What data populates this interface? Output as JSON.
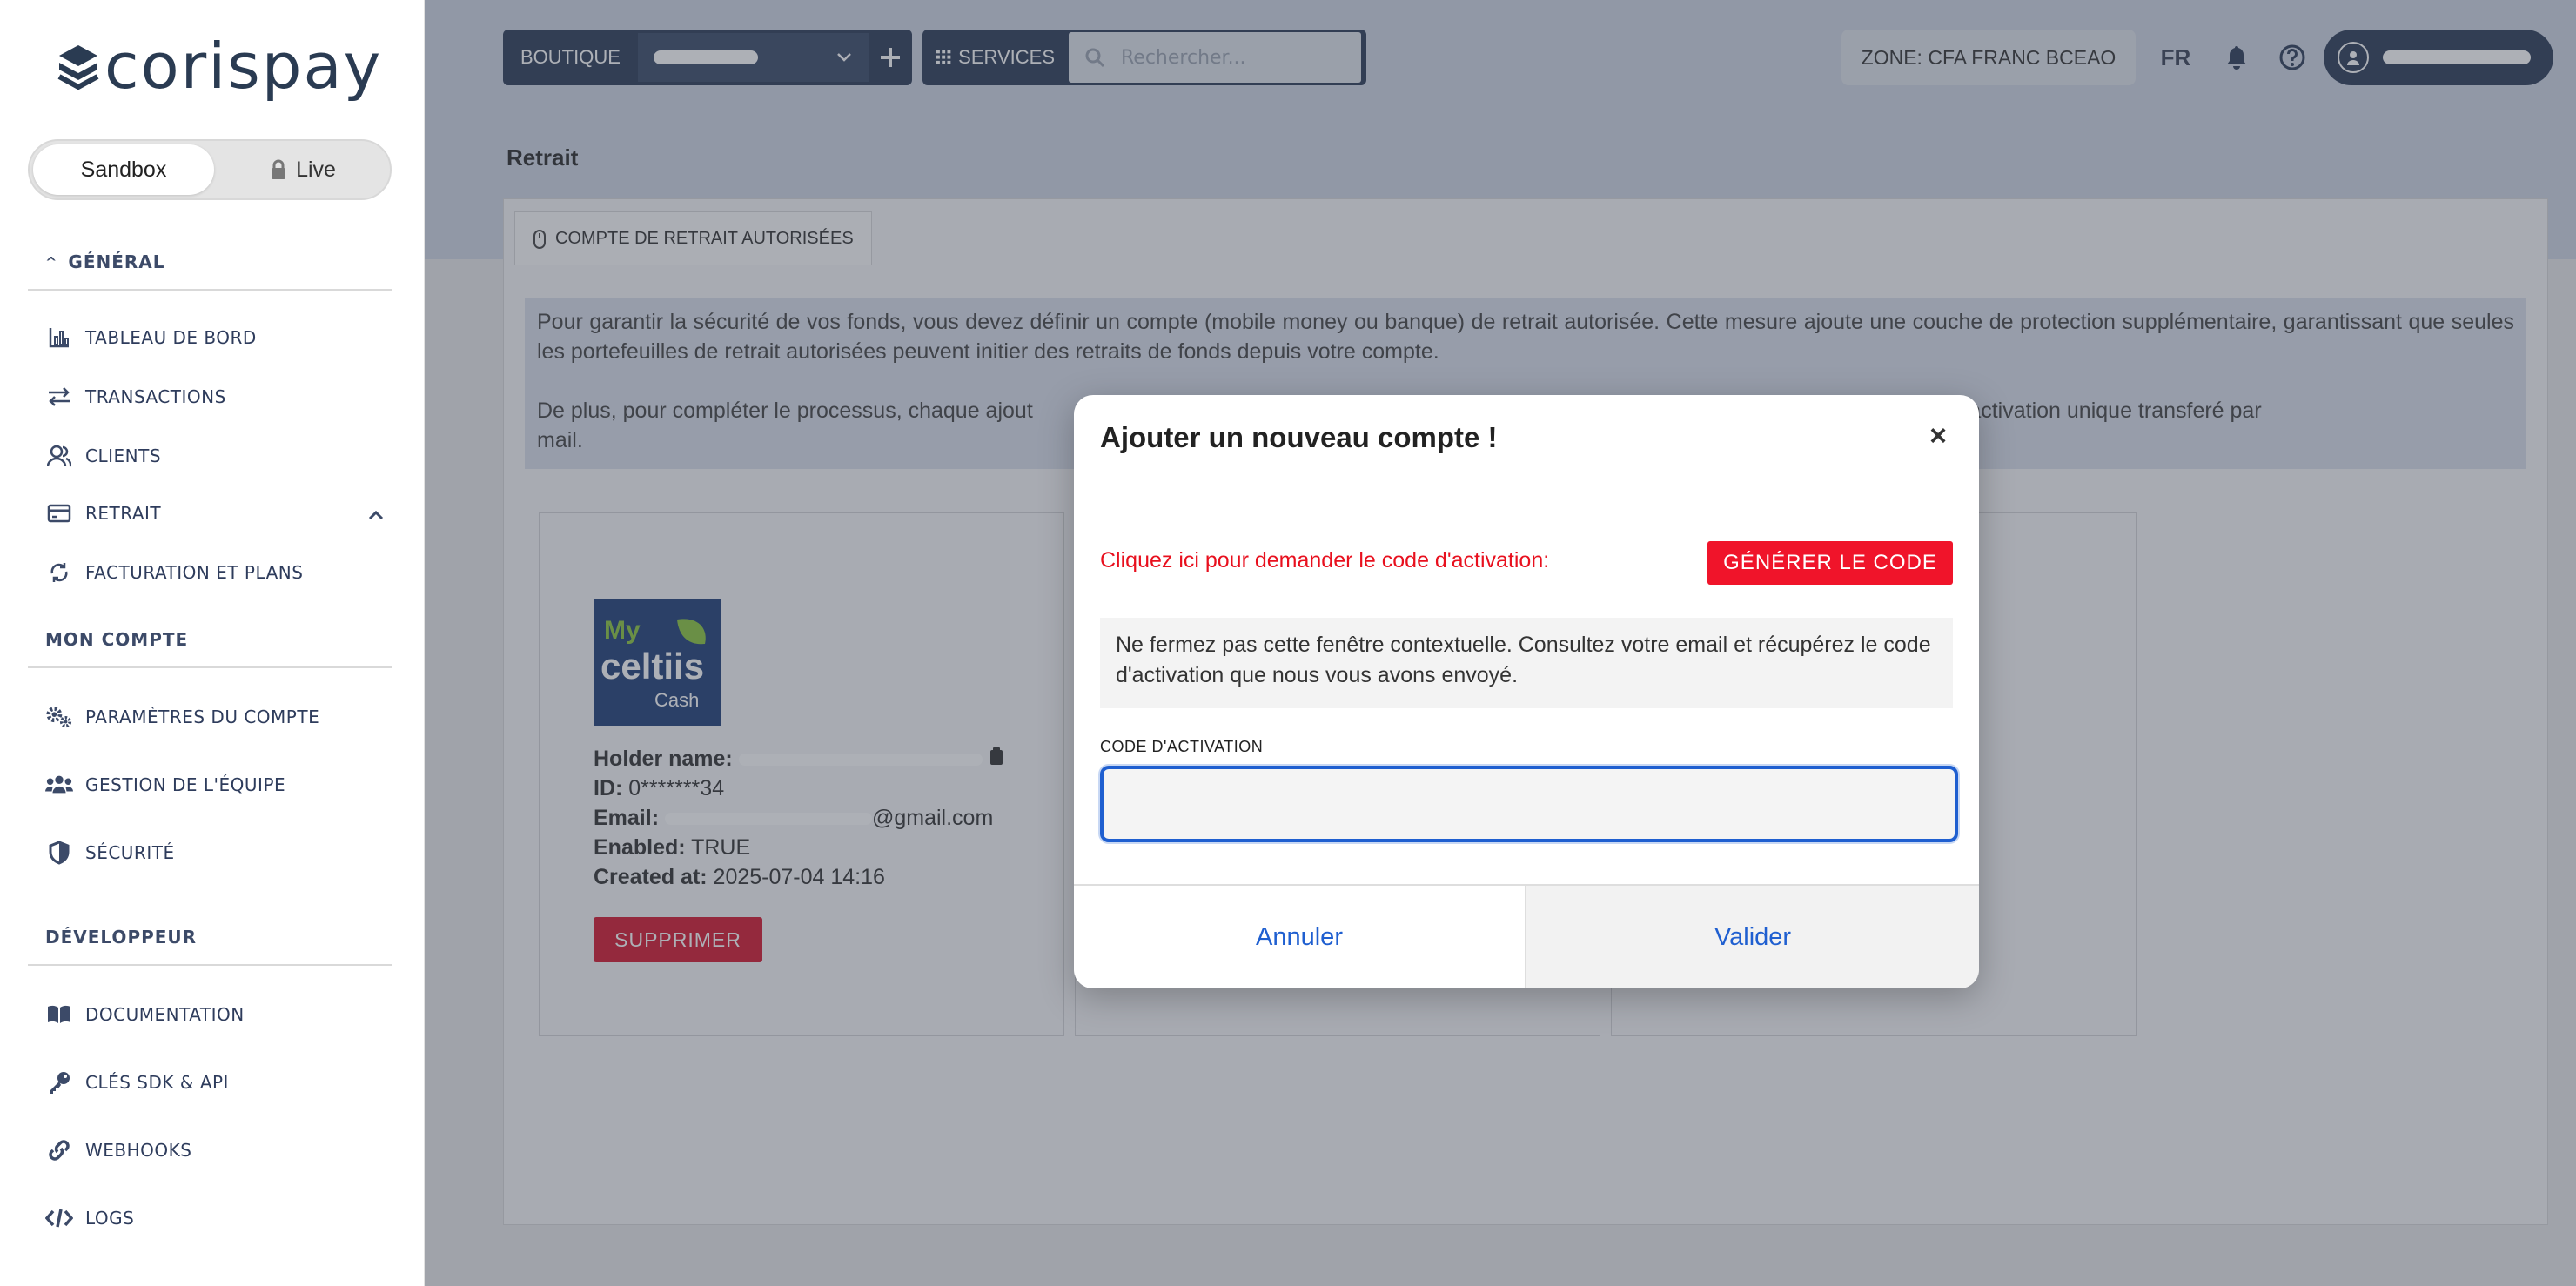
{
  "brand": {
    "name": "corispay"
  },
  "environment": {
    "sandbox": "Sandbox",
    "live": "Live"
  },
  "nav": {
    "general": {
      "title": "GÉNÉRAL",
      "items": [
        "TABLEAU DE BORD",
        "TRANSACTIONS",
        "CLIENTS",
        "RETRAIT",
        "FACTURATION ET PLANS"
      ]
    },
    "account": {
      "title": "MON COMPTE",
      "items": [
        "PARAMÈTRES DU COMPTE",
        "GESTION DE L'ÉQUIPE",
        "SÉCURITÉ"
      ]
    },
    "developer": {
      "title": "DÉVELOPPEUR",
      "items": [
        "DOCUMENTATION",
        "CLÉS SDK & API",
        "WEBHOOKS",
        "LOGS"
      ]
    }
  },
  "topbar": {
    "boutique_label": "BOUTIQUE",
    "services_label": "SERVICES",
    "search_placeholder": "Rechercher...",
    "zone": "ZONE:  CFA FRANC BCEAO",
    "language": "FR"
  },
  "page": {
    "title": "Retrait",
    "tab": "COMPTE DE RETRAIT AUTORISÉES",
    "info_1": "Pour garantir la sécurité de vos fonds, vous devez définir un compte (mobile money ou banque) de retrait autorisée. Cette mesure ajoute une couche de protection supplémentaire, garantissant que seules les portefeuilles de retrait autorisées peuvent initier des retraits de fonds depuis votre compte.",
    "info_2a": "De plus, pour compléter le processus, chaque ajout",
    "info_2b": "rmation d'un code d'activation unique transferé par",
    "info_2c": "mail."
  },
  "account_card": {
    "logo_top": "My",
    "logo_mid": "celtiis",
    "logo_bot": "Cash",
    "holder_label": "Holder name:",
    "id_label": "ID:",
    "id_value": "0*******34",
    "email_label": "Email:",
    "email_suffix": "@gmail.com",
    "enabled_label": "Enabled:",
    "enabled_value": "TRUE",
    "created_label": "Created at:",
    "created_value": "2025-07-04 14:16",
    "delete": "SUPPRIMER"
  },
  "modal": {
    "title": "Ajouter un nouveau compte !",
    "close": "×",
    "prompt": "Cliquez ici pour demander le code d'activation:",
    "generate": "GÉNÉRER LE CODE",
    "notice": "Ne fermez pas cette fenêtre contextuelle. Consultez votre email et récupérez le code d'activation que nous vous avons envoyé.",
    "field_label": "CODE D'ACTIVATION",
    "field_value": "",
    "cancel": "Annuler",
    "confirm": "Valider"
  },
  "colors": {
    "navy": "#2c3b57",
    "accent_red": "#f0142a",
    "link_blue": "#1f5fd0"
  }
}
